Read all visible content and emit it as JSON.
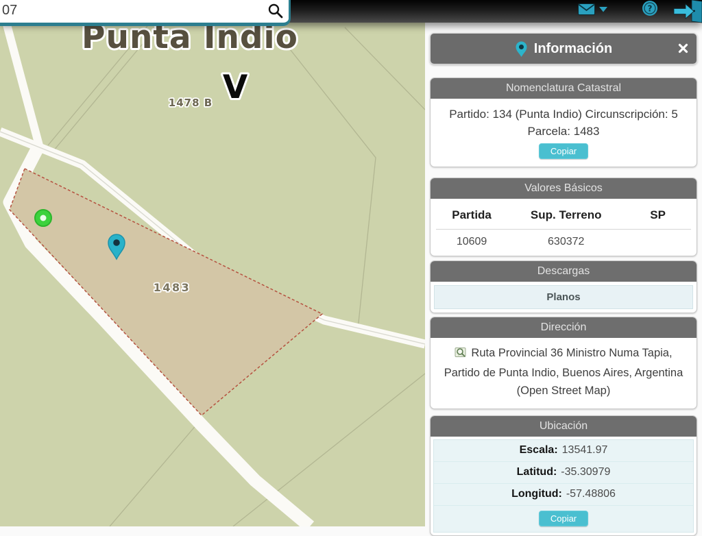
{
  "topbar": {
    "search_value": "07",
    "icons": {
      "search": "magnifier",
      "mail": "envelope",
      "mail_caret": "chevron-down",
      "help": "question-circle",
      "exit": "door-with-arrow"
    }
  },
  "map": {
    "city_label": "Punta Indio",
    "zone_label": "V",
    "parcel_labels": [
      "1478 B",
      "1483"
    ],
    "markers": [
      "green-circle-marker",
      "teal-pin-marker"
    ]
  },
  "panel": {
    "title": "Información",
    "nomenclatura": {
      "title": "Nomenclatura Catastral",
      "line1": "Partido: 134 (Punta Indio) Circunscripción: 5",
      "line2": "Parcela: 1483",
      "copy_button": "Copiar"
    },
    "valores": {
      "title": "Valores Básicos",
      "columns": [
        "Partida",
        "Sup. Terreno",
        "SP"
      ],
      "values": [
        "10609",
        "630372",
        ""
      ]
    },
    "descargas": {
      "title": "Descargas",
      "items": [
        "Planos"
      ]
    },
    "direccion": {
      "title": "Dirección",
      "lines": [
        "Ruta Provincial 36 Ministro Numa Tapia,",
        "Partido de Punta Indio, Buenos Aires, Argentina",
        "(Open Street Map)"
      ]
    },
    "ubicacion": {
      "title": "Ubicación",
      "rows": [
        {
          "label": "Escala:",
          "value": "13541.97"
        },
        {
          "label": "Latitud:",
          "value": "-35.30979"
        },
        {
          "label": "Longitud:",
          "value": "-57.48806"
        }
      ],
      "copy_button": "Copiar"
    }
  },
  "colors": {
    "accent_teal": "#2aa0bf",
    "button_teal": "#4abfd0",
    "panel_gray": "#6e6e6e",
    "map_background": "#cdd3ab",
    "parcel_fill": "#d3c6a6",
    "parcel_border": "#b5513f",
    "light_cyan": "#e9f4f6"
  }
}
